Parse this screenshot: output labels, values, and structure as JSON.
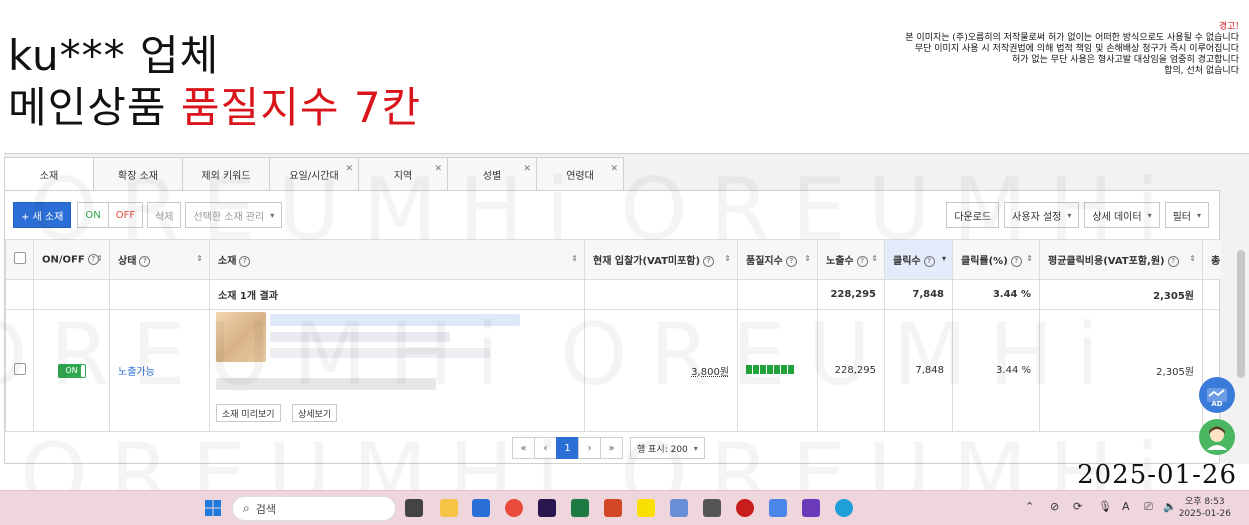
{
  "header": {
    "line1": "ku*** 업체",
    "line2_prefix": "메인상품",
    "line2_highlight": "품질지수 7칸"
  },
  "warning": {
    "title": "경고!",
    "lines": [
      "본 이미지는 (주)오름히의 저작물로써 허가 없이는 어떠한 방식으로도 사용될 수 없습니다",
      "무단 이미지 사용 시 저작권법에 의해 법적 책임 및 손해배상 청구가 즉시 이루어집니다",
      "허가 없는 무단 사용은 형사고발 대상임을 엄중히 경고합니다",
      "합의, 선처 없습니다"
    ]
  },
  "tabs": [
    {
      "label": "소재",
      "closable": false
    },
    {
      "label": "확장 소재",
      "closable": false
    },
    {
      "label": "제외 키워드",
      "closable": false
    },
    {
      "label": "요일/시간대",
      "closable": true
    },
    {
      "label": "지역",
      "closable": true
    },
    {
      "label": "성별",
      "closable": true
    },
    {
      "label": "연령대",
      "closable": true
    }
  ],
  "toolbar": {
    "new_label": "+ 새 소재",
    "on_label": "ON",
    "off_label": "OFF",
    "delete_label": "삭제",
    "manage_label": "선택한 소재 관리",
    "download_label": "다운로드",
    "user_setting_label": "사용자 설정",
    "detail_data_label": "상세 데이터",
    "filter_label": "필터"
  },
  "table": {
    "headers": {
      "onoff": "ON/OFF",
      "status": "상태",
      "ad": "소재",
      "bid": "현재 입찰가(VAT미포함)",
      "quality": "품질지수",
      "impressions": "노출수",
      "clicks": "클릭수",
      "ctr": "클릭률(%)",
      "cpc": "평균클릭비용(VAT포함,원)",
      "cost": "총비용"
    },
    "summary": {
      "label": "소재 1개 결과",
      "impressions": "228,295",
      "clicks": "7,848",
      "ctr": "3.44 %",
      "cpc": "2,305원"
    },
    "row": {
      "toggle": "ON",
      "status": "노출가능",
      "preview_label": "소재 미리보기",
      "detail_label": "상세보기",
      "bid": "3,800원",
      "quality_level": 7,
      "impressions": "228,295",
      "clicks": "7,848",
      "ctr": "3.44 %",
      "cpc": "2,305원"
    }
  },
  "pager": {
    "first": "«",
    "prev": "‹",
    "current": "1",
    "next": "›",
    "last": "»",
    "page_size": "행 표시: 200"
  },
  "fab": {
    "ad_label": "AD"
  },
  "watermark": {
    "text": "OREUMHi"
  },
  "date_overlay": "2025-01-26",
  "taskbar": {
    "search_label": "검색",
    "clock_time": "오후 8:53",
    "clock_date": "2025-01-26"
  }
}
